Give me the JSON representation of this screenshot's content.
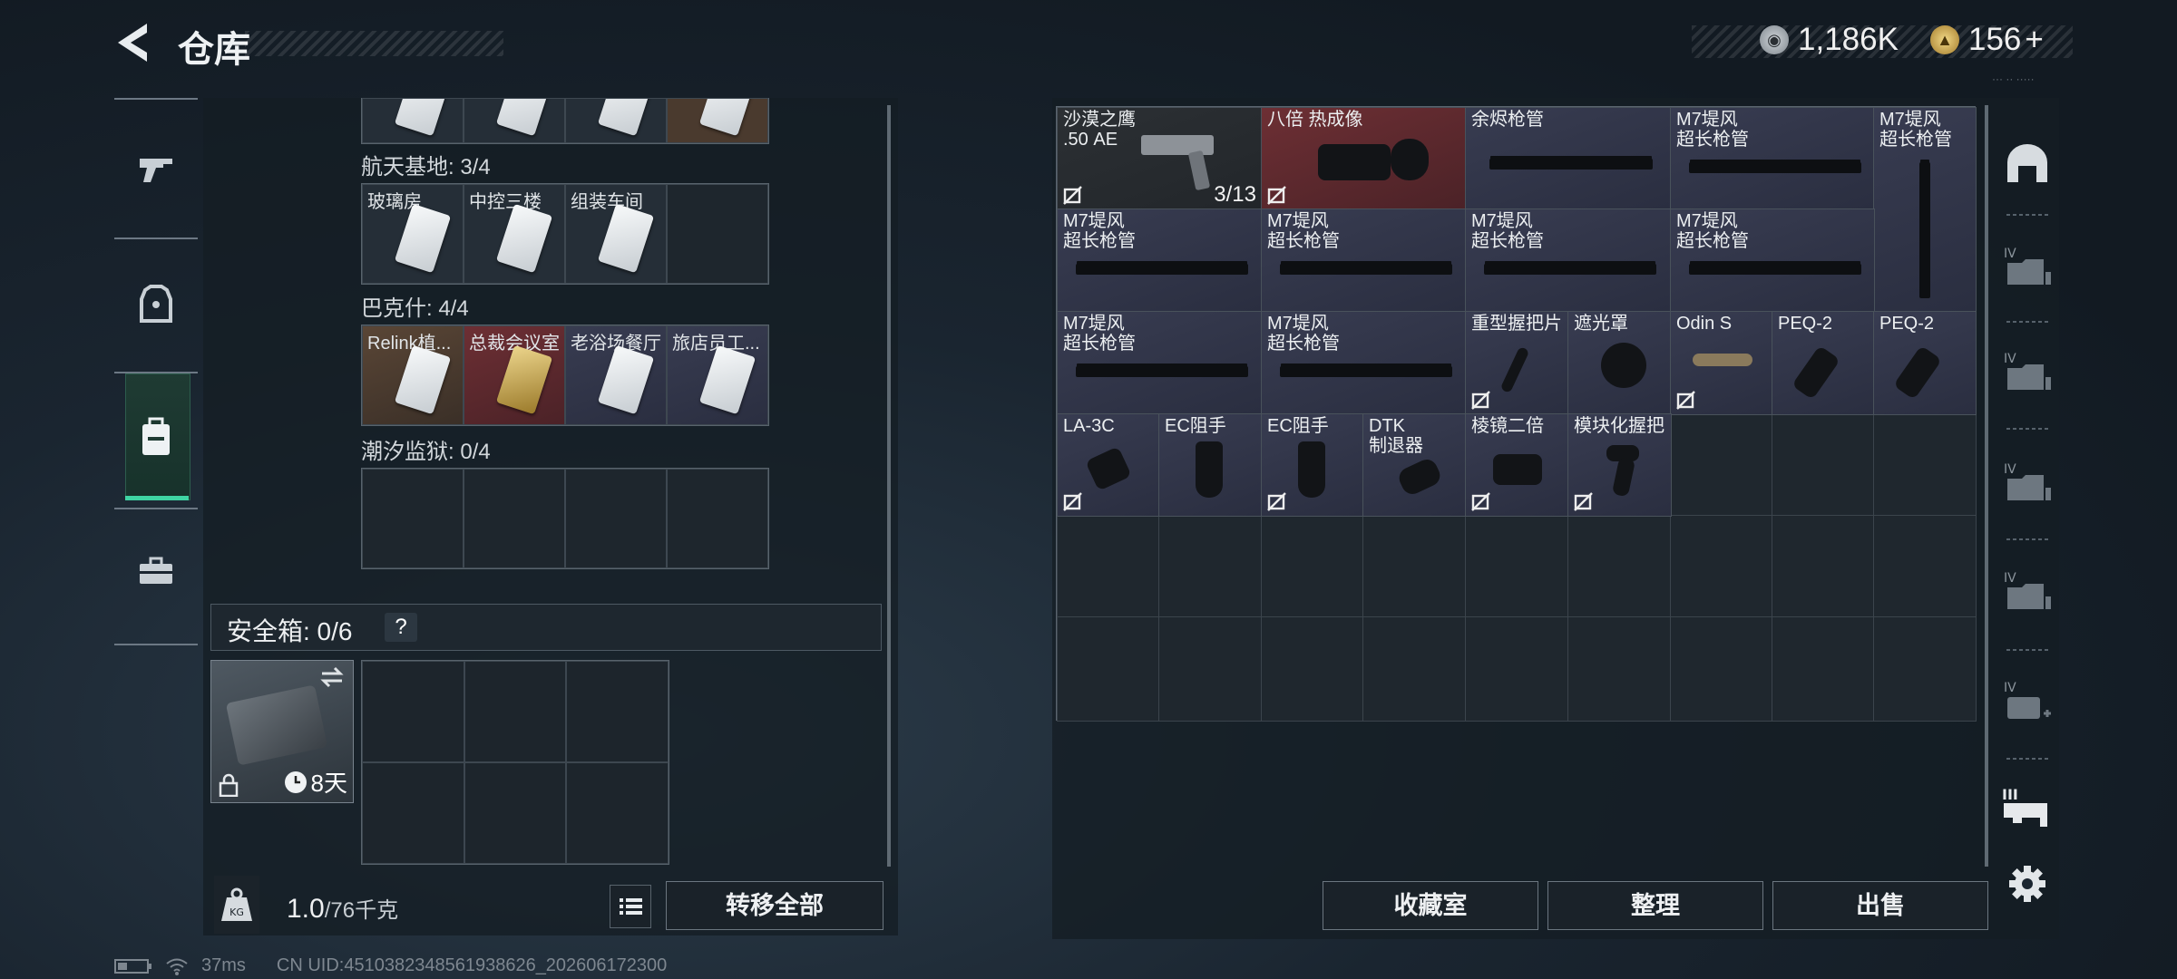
{
  "header": {
    "title": "仓库"
  },
  "currency": {
    "silver_amount": "1,186K",
    "gold_amount": "156",
    "gold_add": "+"
  },
  "nav": {
    "items": [
      "weapon-icon",
      "armor-icon",
      "backpack-icon",
      "toolbox-icon"
    ],
    "active": "backpack-icon"
  },
  "keycard_sections": [
    {
      "label": "航天基地: 3/4",
      "cards": [
        {
          "name": "玻璃房",
          "type": "silver"
        },
        {
          "name": "中控三楼",
          "type": "silver"
        },
        {
          "name": "组装车间",
          "type": "silver"
        },
        {
          "name": "",
          "type": "empty"
        }
      ]
    },
    {
      "label": "巴克什: 4/4",
      "cards": [
        {
          "name": "Relink植...",
          "type": "silver"
        },
        {
          "name": "总裁会议室",
          "type": "gold"
        },
        {
          "name": "老浴场餐厅",
          "type": "silver"
        },
        {
          "name": "旅店员工...",
          "type": "silver"
        }
      ]
    },
    {
      "label": "潮汐监狱: 0/4",
      "cards": [
        {
          "name": "",
          "type": "empty"
        },
        {
          "name": "",
          "type": "empty"
        },
        {
          "name": "",
          "type": "empty"
        },
        {
          "name": "",
          "type": "empty"
        }
      ]
    }
  ],
  "safe_box": {
    "label": "安全箱: 0/6",
    "help": "?",
    "days": "8天"
  },
  "footer_left": {
    "weight": "1.0",
    "weight_max": "/76千克",
    "transfer_all": "转移全部"
  },
  "stash_items": [
    {
      "name": "沙漠之鹰\n.50 AE",
      "count": "3/13",
      "style": "dark",
      "uninsured": true
    },
    {
      "name": "八倍 热成像",
      "style": "red",
      "uninsured": true
    },
    {
      "name": "余烬枪管",
      "style": "purple"
    },
    {
      "name": "M7堤风\n超长枪管",
      "style": "purple"
    },
    {
      "name": "M7堤风\n超长枪管",
      "style": "purple"
    },
    {
      "name": "M7堤风\n超长枪管",
      "style": "purple"
    },
    {
      "name": "M7堤风\n超长枪管",
      "style": "purple"
    },
    {
      "name": "M7堤风\n超长枪管",
      "style": "purple"
    },
    {
      "name": "M7堤风\n超长枪管",
      "style": "purple"
    },
    {
      "name": "M7堤风\n超长枪管",
      "style": "purple"
    },
    {
      "name": "M7堤风\n超长枪管",
      "style": "purple"
    },
    {
      "name": "重型握把片",
      "style": "purple",
      "uninsured": true
    },
    {
      "name": "遮光罩",
      "style": "purple"
    },
    {
      "name": "Odin S",
      "style": "purple",
      "uninsured": true
    },
    {
      "name": "PEQ-2",
      "style": "purple"
    },
    {
      "name": "PEQ-2",
      "style": "purple"
    },
    {
      "name": "LA-3C",
      "style": "purple",
      "uninsured": true
    },
    {
      "name": "EC阻手",
      "style": "purple"
    },
    {
      "name": "EC阻手",
      "style": "purple",
      "uninsured": true
    },
    {
      "name": "DTK\n制退器",
      "style": "purple"
    },
    {
      "name": "棱镜二倍",
      "style": "purple",
      "uninsured": true
    },
    {
      "name": "模块化握把",
      "style": "purple",
      "uninsured": true
    }
  ],
  "right_sidebar": [
    "stash-tab-icon",
    "storage-iv-icon",
    "storage-iv-icon",
    "storage-iv-icon",
    "storage-iv-icon",
    "storage-add-iv-icon",
    "storage-iii-icon",
    "settings-icon"
  ],
  "footer_right": {
    "collection": "收藏室",
    "organize": "整理",
    "sell": "出售"
  },
  "status": {
    "ping": "37ms",
    "uid": "CN UID:4510382348561938626_202606172300"
  }
}
